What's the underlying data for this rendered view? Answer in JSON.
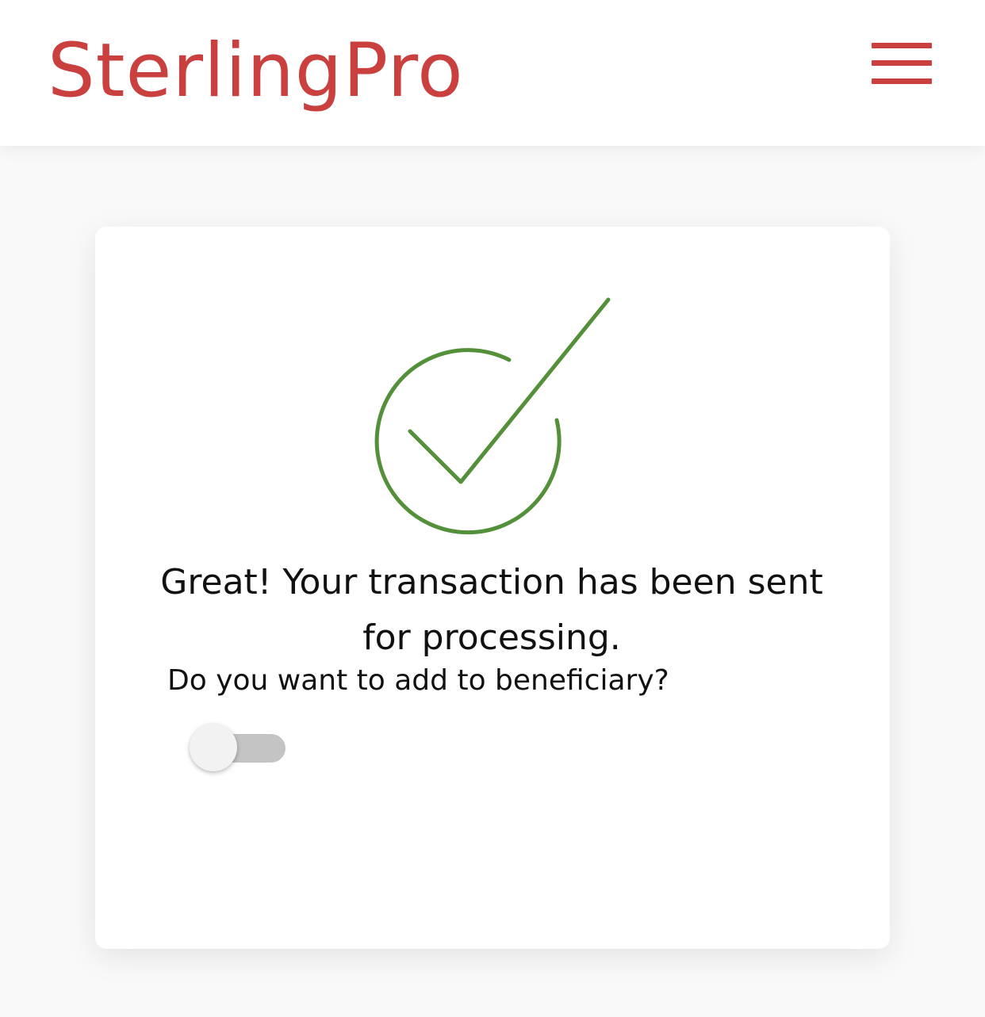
{
  "header": {
    "brand": "SterlingPro",
    "menu_icon": "hamburger-menu-icon"
  },
  "success": {
    "icon": "check-circle-icon",
    "message": "Great! Your transaction has been sent for processing.",
    "question": "Do you want to add to beneficiary?"
  },
  "toggle": {
    "name": "add-to-beneficiary",
    "checked": false
  },
  "colors": {
    "brand": "#c9403f",
    "success": "#548f3a",
    "text": "#111111",
    "background": "#f9f9f9",
    "toggle_track_off": "#c4c4c4",
    "toggle_thumb": "#f2f2f2"
  }
}
